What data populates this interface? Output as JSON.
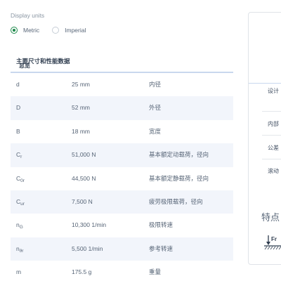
{
  "display_units": {
    "label": "Display units",
    "options": [
      {
        "label": "Metric",
        "selected": true
      },
      {
        "label": "Imperial",
        "selected": false
      }
    ]
  },
  "table": {
    "header": "主要尺寸和性能数据",
    "rows": [
      {
        "symbol": "d",
        "sub": "",
        "value": "25 mm",
        "description": "内径"
      },
      {
        "symbol": "D",
        "sub": "",
        "value": "52 mm",
        "description": "外径"
      },
      {
        "symbol": "B",
        "sub": "",
        "value": "18 mm",
        "description": "宽度"
      },
      {
        "symbol": "C",
        "sub": "r",
        "value": "51,000 N",
        "description": "基本额定动载荷，径向"
      },
      {
        "symbol": "C",
        "sub": "0r",
        "value": "44,500 N",
        "description": "基本额定静载荷，径向"
      },
      {
        "symbol": "C",
        "sub": "ur",
        "value": "7,500 N",
        "description": "疲劳极限载荷，径向"
      },
      {
        "symbol": "n",
        "sub": "G",
        "value": "10,300 1/min",
        "description": "极限转速"
      },
      {
        "symbol": "n",
        "sub": "ϑr",
        "value": "5,500 1/min",
        "description": "参考转速"
      },
      {
        "symbol": "m",
        "sub": "",
        "value": "175.5 g",
        "description": "重量"
      }
    ]
  },
  "side_panel": {
    "header": "总览",
    "items": [
      "设计",
      "内部",
      "公差",
      "滚动"
    ],
    "features_title": "特点",
    "force_icon_label": "Fr",
    "colors": {
      "accent": "#1f8a4c",
      "divider": "#c9d8ee",
      "row_shade": "#f2f5fb"
    }
  }
}
